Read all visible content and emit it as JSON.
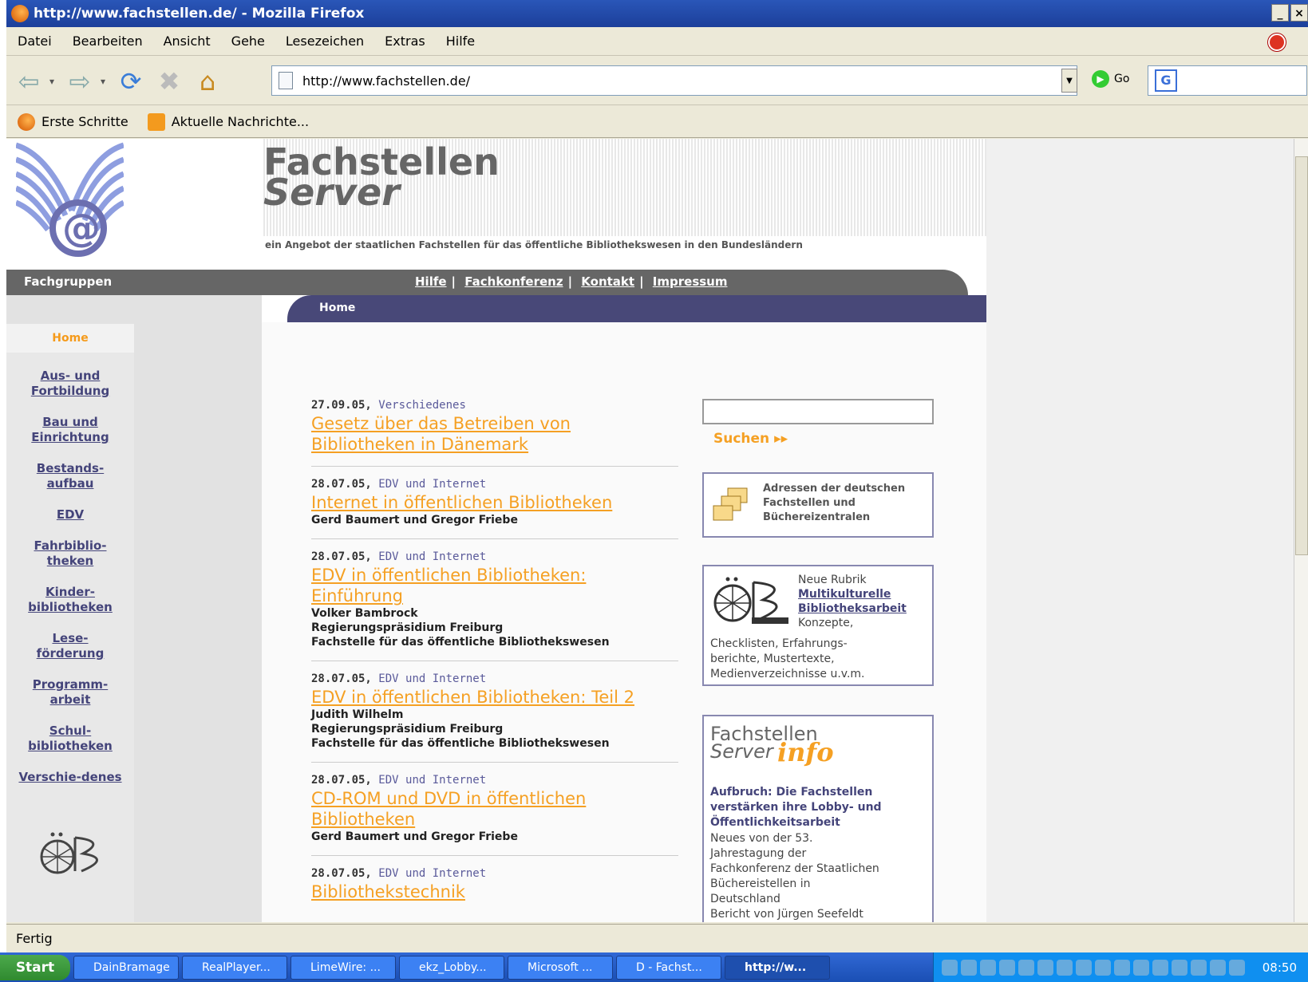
{
  "window": {
    "title": "http://www.fachstellen.de/ - Mozilla Firefox",
    "min": "_",
    "max": "×"
  },
  "menu": [
    "Datei",
    "Bearbeiten",
    "Ansicht",
    "Gehe",
    "Lesezeichen",
    "Extras",
    "Hilfe"
  ],
  "nav": {
    "url": "http://www.fachstellen.de/",
    "go": "Go",
    "search_logo": "G"
  },
  "bookmarks": [
    "Erste Schritte",
    "Aktuelle Nachrichte..."
  ],
  "page": {
    "brand_line1": "Fachstellen",
    "brand_line2": "Server",
    "tagline": "ein Angebot der staatlichen Fachstellen für das öffentliche Bibliothekswesen in den Bundesländern",
    "fachgruppen": "Fachgruppen",
    "toplinks": [
      "Hilfe",
      "Fachkonferenz",
      "Kontakt",
      "Impressum"
    ],
    "breadcrumb": "Home",
    "sidebar": {
      "home": "Home",
      "items": [
        [
          "Aus- und",
          "Fortbildung"
        ],
        [
          "Bau und",
          "Einrichtung"
        ],
        [
          "Bestands-",
          "aufbau"
        ],
        [
          "EDV",
          ""
        ],
        [
          "Fahrbiblio-",
          "theken"
        ],
        [
          "Kinder-",
          "bibliotheken"
        ],
        [
          "Lese-",
          "förderung"
        ],
        [
          "Programm-",
          "arbeit"
        ],
        [
          "Schul-",
          "bibliotheken"
        ],
        [
          "Verschie-denes",
          ""
        ]
      ]
    },
    "news": [
      {
        "date": "27.09.05,",
        "cat": "Verschiedenes",
        "title": "Gesetz über das Betreiben von Bibliotheken in Dänemark",
        "desc": []
      },
      {
        "date": "28.07.05,",
        "cat": "EDV und Internet",
        "title": "Internet in öffentlichen Bibliotheken",
        "desc": [
          "Gerd Baumert und Gregor Friebe"
        ]
      },
      {
        "date": "28.07.05,",
        "cat": "EDV und Internet",
        "title": "EDV in öffentlichen Bibliotheken: Einführung",
        "desc": [
          "Volker Bambrock",
          "Regierungspräsidium Freiburg",
          "Fachstelle für das öffentliche Bibliothekswesen"
        ]
      },
      {
        "date": "28.07.05,",
        "cat": "EDV und Internet",
        "title": "EDV in öffentlichen Bibliotheken: Teil 2",
        "desc": [
          "Judith Wilhelm",
          "Regierungspräsidium Freiburg",
          "Fachstelle für das öffentliche Bibliothekswesen"
        ]
      },
      {
        "date": "28.07.05,",
        "cat": "EDV und Internet",
        "title": "CD-ROM und DVD in öffentlichen Bibliotheken",
        "desc": [
          "Gerd Baumert und Gregor Friebe"
        ]
      },
      {
        "date": "28.07.05,",
        "cat": "EDV und Internet",
        "title": "Bibliothekstechnik",
        "desc": []
      }
    ],
    "search_label": "Suchen ▸▸",
    "box1": [
      "Adressen der deutschen",
      "Fachstellen und",
      "Büchereizentralen"
    ],
    "box2": {
      "line1": "Neue Rubrik",
      "link1": "Multikulturelle",
      "link2": "Bibliotheksarbeit",
      "line2": "Konzepte,",
      "rest": [
        "Checklisten, Erfahrungs-",
        "berichte, Mustertexte,",
        "Medienverzeichnisse u.v.m."
      ]
    },
    "box3": {
      "l1": "Fachstellen",
      "l2": "Server",
      "l3": "info",
      "headline": [
        "Aufbruch: Die Fachstellen",
        "verstärken ihre Lobby- und",
        "Öffentlichkeitsarbeit"
      ],
      "body": [
        "Neues von der 53.",
        "Jahrestagung der",
        "Fachkonferenz der Staatlichen",
        "Büchereistellen in",
        "Deutschland",
        "Bericht von Jürgen Seefeldt"
      ]
    }
  },
  "status": "Fertig",
  "taskbar": {
    "start": "Start",
    "tasks": [
      "DainBramage",
      "RealPlayer...",
      "LimeWire: ...",
      "ekz_Lobby...",
      "Microsoft ...",
      "D - Fachst...",
      "http://w..."
    ],
    "clock": "08:50"
  }
}
